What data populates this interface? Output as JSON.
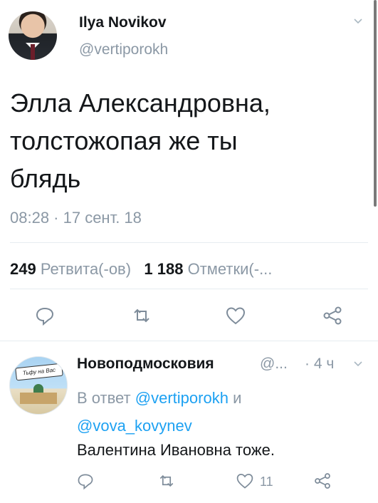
{
  "tweet": {
    "author_name": "Ilya Novikov",
    "author_handle": "@vertiporokh",
    "text": "Элла Александровна,\nтолстожопая же ты\nблядь",
    "timestamp": "08:28 · 17 сент. 18",
    "retweets_count": "249",
    "retweets_label": "Ретвита(-ов)",
    "likes_count": "1 188",
    "likes_label": "Отметки(-..."
  },
  "reply": {
    "author_name": "Новоподмосковия",
    "author_handle": "@...",
    "time": "· 4 ч",
    "reply_prefix": "В ответ",
    "reply_to_1": "@vertiporokh",
    "reply_and": "и",
    "reply_to_2": "@vova_kovynev",
    "text": "Валентина Ивановна тоже.",
    "like_count": "11",
    "avatar_banner": "Тьфу на Вас"
  },
  "icons": [
    "reply-icon",
    "retweet-icon",
    "like-icon",
    "share-icon",
    "chevron-down-icon"
  ],
  "colors": {
    "accent": "#1da1f2",
    "secondary_text": "#8b98a5",
    "primary_text": "#14171a"
  }
}
